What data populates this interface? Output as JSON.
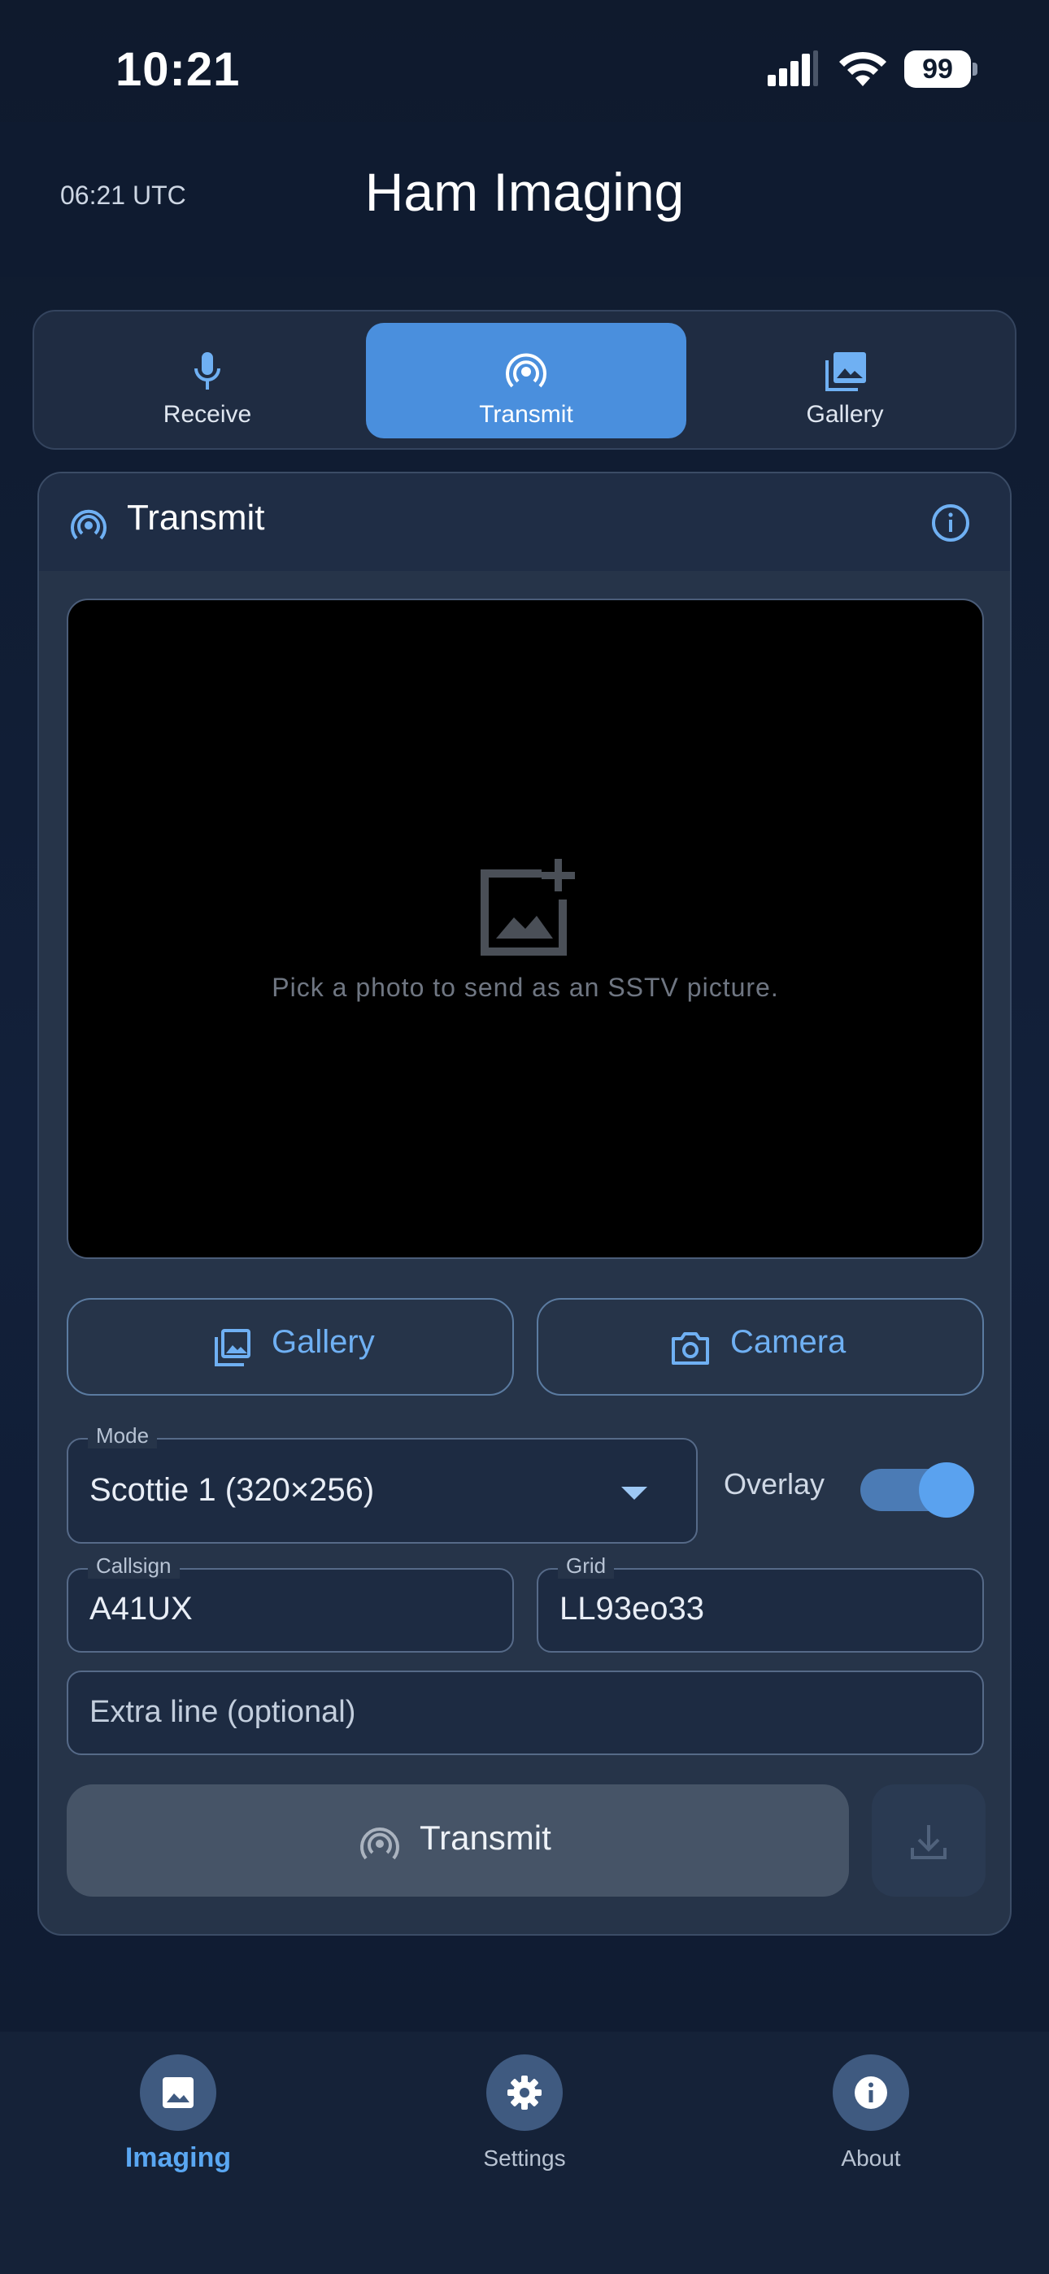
{
  "status_bar": {
    "time": "10:21",
    "battery": "99"
  },
  "header": {
    "utc_time": "06:21 UTC",
    "title": "Ham Imaging"
  },
  "segment_tabs": [
    {
      "label": "Receive",
      "icon": "microphone-icon",
      "active": false
    },
    {
      "label": "Transmit",
      "icon": "broadcast-icon",
      "active": true
    },
    {
      "label": "Gallery",
      "icon": "photo-library-icon",
      "active": false
    }
  ],
  "card": {
    "title": "Transmit",
    "preview_hint": "Pick a photo to send as an SSTV picture.",
    "gallery_button": "Gallery",
    "camera_button": "Camera",
    "mode": {
      "label": "Mode",
      "value": "Scottie 1  (320×256)"
    },
    "overlay": {
      "label": "Overlay",
      "enabled": true
    },
    "callsign": {
      "label": "Callsign",
      "value": "A41UX"
    },
    "grid": {
      "label": "Grid",
      "value": "LL93eo33"
    },
    "extra_line": {
      "placeholder": "Extra line (optional)",
      "value": ""
    },
    "transmit_button": "Transmit"
  },
  "bottom_nav": [
    {
      "label": "Imaging",
      "icon": "image-icon",
      "active": true
    },
    {
      "label": "Settings",
      "icon": "gear-icon",
      "active": false
    },
    {
      "label": "About",
      "icon": "info-icon",
      "active": false
    }
  ],
  "colors": {
    "accent": "#4a8fdd",
    "link": "#6fb0f3",
    "background": "#0f1a2c"
  }
}
